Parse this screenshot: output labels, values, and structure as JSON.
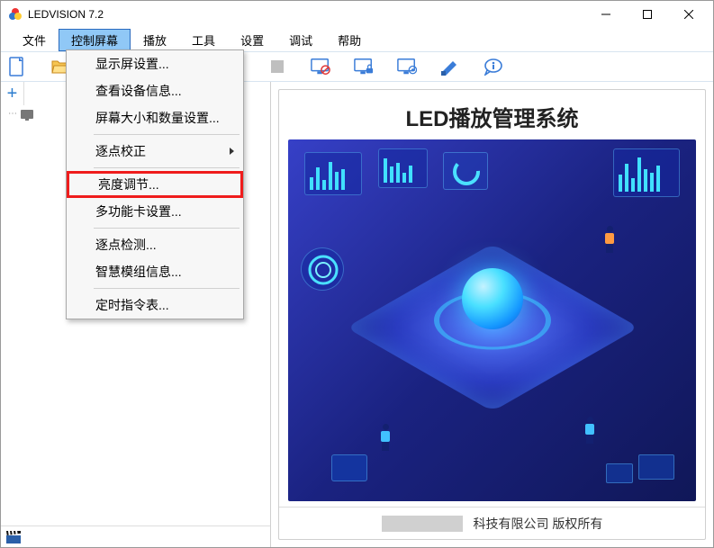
{
  "title": "LEDVISION 7.2",
  "menubar": [
    "文件",
    "控制屏幕",
    "播放",
    "工具",
    "设置",
    "调试",
    "帮助"
  ],
  "menubar_active_index": 1,
  "dropdown": {
    "groups": [
      [
        "显示屏设置...",
        "查看设备信息...",
        "屏幕大小和数量设置..."
      ],
      [
        "逐点校正"
      ],
      [
        "亮度调节...",
        "多功能卡设置..."
      ],
      [
        "逐点检测...",
        "智慧模组信息..."
      ],
      [
        "定时指令表..."
      ]
    ],
    "arrow_items": [
      "逐点校正"
    ],
    "highlighted": "亮度调节..."
  },
  "panel": {
    "title": "LED播放管理系统",
    "footer_suffix": "科技有限公司  版权所有"
  }
}
